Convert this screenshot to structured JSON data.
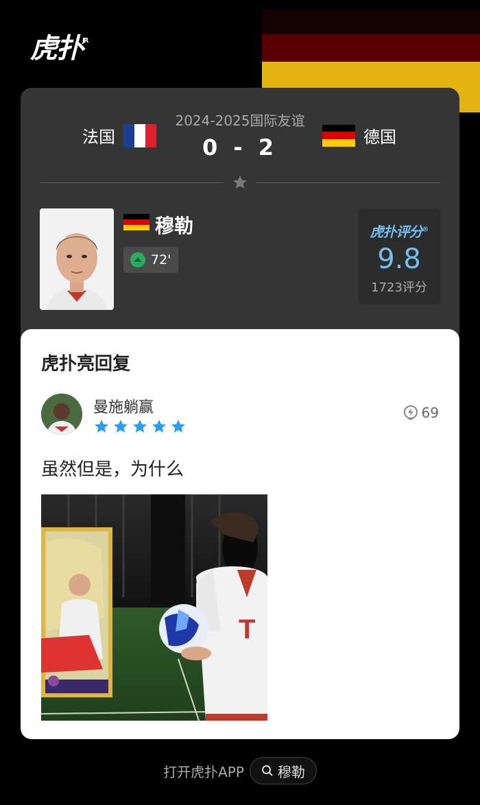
{
  "app": {
    "logo_text": "虎扑",
    "logo_mark": "JR"
  },
  "match": {
    "competition": "2024-2025国际友谊",
    "home_team": "法国",
    "away_team": "德国",
    "score": "0 - 2"
  },
  "player": {
    "name": "穆勒",
    "sub_minute": "72'",
    "rating_brand": "虎扑评分",
    "rating_value": "9.8",
    "rating_count": "1723评分"
  },
  "reply": {
    "section_title": "虎扑亮回复",
    "username": "曼施躺赢",
    "stars": 5,
    "likes": "69",
    "text": "虽然但是，为什么"
  },
  "footer": {
    "open_app": "打开虎扑APP",
    "search_term": "穆勒"
  },
  "colors": {
    "accent_blue": "#6fbfee",
    "star_blue": "#2a9df4",
    "card_dark": "#353535"
  },
  "icons": [
    "star-icon",
    "substitution-icon",
    "lightning-like-icon",
    "search-icon"
  ]
}
